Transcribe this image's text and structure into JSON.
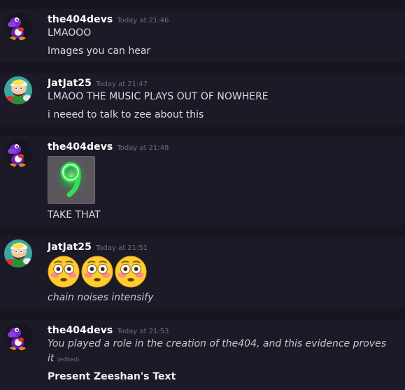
{
  "messages": [
    {
      "author": "the404devs",
      "timestamp": "Today at 21:46",
      "lines": [
        "LMAOOO",
        "Images you can hear"
      ]
    },
    {
      "author": "JatJat25",
      "timestamp": "Today at 21:47",
      "lines": [
        "LMAOO THE MUSIC PLAYS OUT OF NOWHERE",
        "i neeed to talk to zee about this"
      ]
    },
    {
      "author": "the404devs",
      "timestamp": "Today at 21:48",
      "attachment": "green-glowing-nine-image",
      "lines": [
        "TAKE THAT"
      ]
    },
    {
      "author": "JatJat25",
      "timestamp": "Today at 21:51",
      "emojis": [
        "flushed-face",
        "flushed-face",
        "flushed-face"
      ],
      "lines": [
        "chain noises intensify"
      ]
    },
    {
      "author": "the404devs",
      "timestamp": "Today at 21:53",
      "lines": [
        "You played a role in the creation of the404, and this evidence proves",
        "it",
        "Present Zeeshan's Text"
      ],
      "edited_label": "(edited)"
    }
  ],
  "colors": {
    "background": "#17151f",
    "message_bg": "#1c1a26",
    "glow_green": "#38e85a"
  }
}
